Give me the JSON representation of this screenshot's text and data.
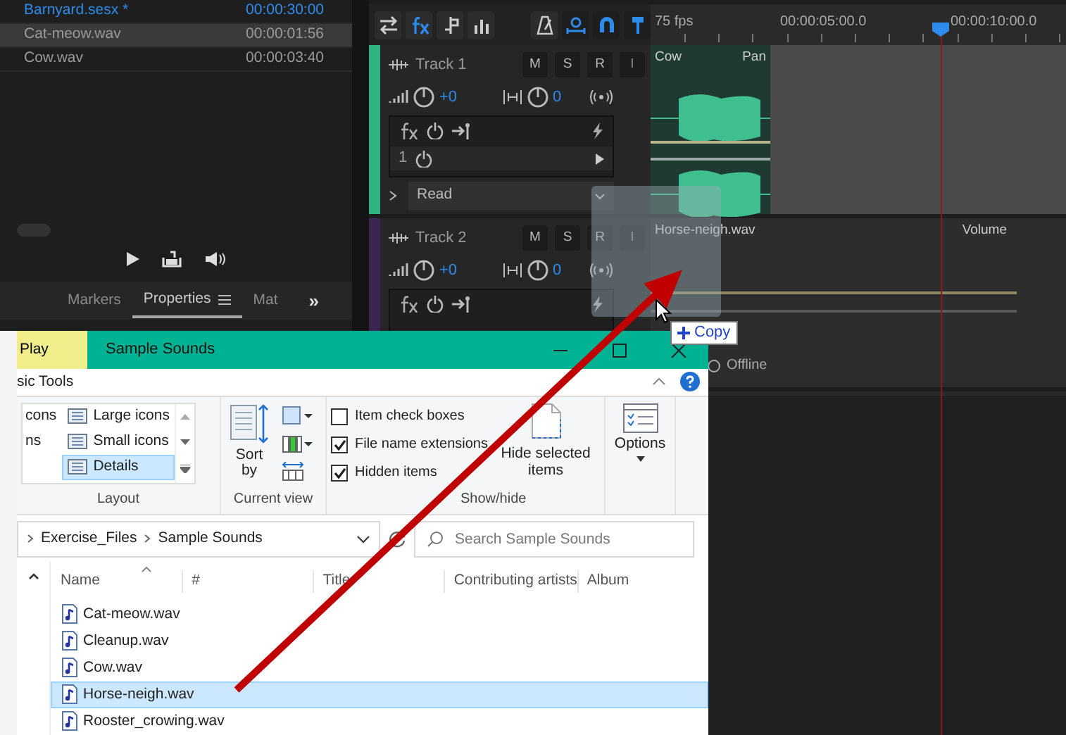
{
  "audition": {
    "files": [
      {
        "name": "Barnyard.sesx *",
        "duration": "00:00:30:00",
        "kind": "session",
        "selected": false
      },
      {
        "name": "Cat-meow.wav",
        "duration": "00:00:01:56",
        "kind": "audio",
        "selected": true
      },
      {
        "name": "Cow.wav",
        "duration": "00:00:03:40",
        "kind": "audio",
        "selected": false
      }
    ],
    "panel_tabs": [
      {
        "label": "Markers",
        "selected": false
      },
      {
        "label": "Properties",
        "selected": true
      },
      {
        "label": "Mat",
        "selected": false
      }
    ],
    "more_tabs": "»",
    "ruler": {
      "fps": "75 fps",
      "ticks": [
        "00:00:05:00.0",
        "00:00:10:00.0"
      ]
    },
    "tracks": [
      {
        "name": "Track 1",
        "color": "#2fb383",
        "buttons": [
          {
            "label": "M",
            "disabled": false
          },
          {
            "label": "S",
            "disabled": false
          },
          {
            "label": "R",
            "disabled": false
          },
          {
            "label": "I",
            "disabled": true
          }
        ],
        "volume": "+0",
        "pan": "0",
        "fx_slots": [
          "1"
        ],
        "automation": "Read",
        "clip": {
          "name": "Cow",
          "envelope": "Pan",
          "kind": "waveform"
        }
      },
      {
        "name": "Track 2",
        "color": "#3a2650",
        "buttons": [
          {
            "label": "M",
            "disabled": false
          },
          {
            "label": "S",
            "disabled": false
          },
          {
            "label": "R",
            "disabled": false
          },
          {
            "label": "I",
            "disabled": true
          }
        ],
        "volume": "+0",
        "pan": "0",
        "clip": {
          "name": "Horse-neigh.wav",
          "envelope": "Volume",
          "kind": "empty"
        }
      }
    ],
    "offline": "Offline"
  },
  "drag": {
    "tooltip": "Copy"
  },
  "explorer": {
    "context_tab": "Play",
    "title": "Sample Sounds",
    "ribbon_tab": "sic Tools",
    "layout": {
      "label": "Layout",
      "columns": [
        {
          "items": [
            {
              "label": "cons",
              "selected": false
            },
            {
              "label": "ns",
              "selected": false
            }
          ]
        },
        {
          "items": [
            {
              "label": "Large icons",
              "selected": false
            },
            {
              "label": "Small icons",
              "selected": false
            },
            {
              "label": "Details",
              "selected": true
            }
          ]
        }
      ]
    },
    "current_view": {
      "label": "Current view",
      "sort": "Sort by"
    },
    "show_hide": {
      "label": "Show/hide",
      "checks": [
        {
          "label": "Item check boxes",
          "checked": false
        },
        {
          "label": "File name extensions",
          "checked": true
        },
        {
          "label": "Hidden items",
          "checked": true
        }
      ],
      "hide_selected": "Hide selected items"
    },
    "options": "Options",
    "breadcrumb": [
      "Exercise_Files",
      "Sample Sounds"
    ],
    "search": {
      "placeholder": "Search Sample Sounds"
    },
    "columns": [
      "Name",
      "#",
      "Title",
      "Contributing artists",
      "Album"
    ],
    "files": [
      {
        "name": "Cat-meow.wav",
        "selected": false
      },
      {
        "name": "Cleanup.wav",
        "selected": false
      },
      {
        "name": "Cow.wav",
        "selected": false
      },
      {
        "name": "Horse-neigh.wav",
        "selected": true
      },
      {
        "name": "Rooster_crowing.wav",
        "selected": false
      }
    ]
  }
}
